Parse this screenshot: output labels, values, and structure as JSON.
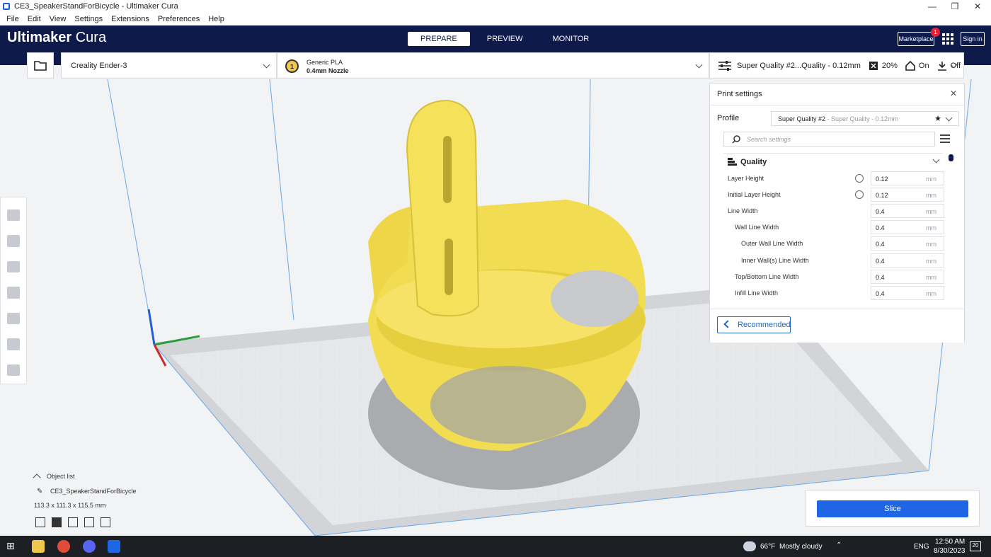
{
  "window": {
    "title": "CE3_SpeakerStandForBicycle - Ultimaker Cura"
  },
  "menu": [
    "File",
    "Edit",
    "View",
    "Settings",
    "Extensions",
    "Preferences",
    "Help"
  ],
  "header": {
    "brand_bold": "Ultimaker",
    "brand_light": " Cura",
    "tabs": [
      {
        "label": "PREPARE"
      },
      {
        "label": "PREVIEW"
      },
      {
        "label": "MONITOR"
      }
    ],
    "marketplace_label": "Marketplace",
    "marketplace_badge": "1",
    "signin_label": "Sign in"
  },
  "toolbar": {
    "printer": "Creality Ender-3",
    "extruder_number": "1",
    "material": "Generic PLA",
    "nozzle": "0.4mm Nozzle",
    "print_profile": "Super Quality #2...Quality - 0.12mm",
    "infill": "20%",
    "support": "On",
    "adhesion": "Off"
  },
  "print_settings": {
    "title": "Print settings",
    "close": "✕",
    "profile_label": "Profile",
    "profile_value": "Super Quality #2",
    "profile_sub": " - Super Quality - 0.12mm",
    "search_placeholder": "Search settings",
    "section": "Quality",
    "settings": [
      {
        "label": "Layer Height",
        "value": "0.12",
        "unit": "mm"
      },
      {
        "label": "Initial Layer Height",
        "value": "0.12",
        "unit": "mm"
      },
      {
        "label": "Line Width",
        "value": "0.4",
        "unit": "mm"
      },
      {
        "label": "Wall Line Width",
        "value": "0.4",
        "unit": "mm"
      },
      {
        "label": "Outer Wall Line Width",
        "value": "0.4",
        "unit": "mm"
      },
      {
        "label": "Inner Wall(s) Line Width",
        "value": "0.4",
        "unit": "mm"
      },
      {
        "label": "Top/Bottom Line Width",
        "value": "0.4",
        "unit": "mm"
      },
      {
        "label": "Infill Line Width",
        "value": "0.4",
        "unit": "mm"
      }
    ],
    "recommended_label": "Recommended"
  },
  "slice": {
    "label": "Slice"
  },
  "object_list": {
    "title": "Object list",
    "object_name": "CE3_SpeakerStandForBicycle",
    "dimensions": "113.3 x 111.3 x 115.5 mm"
  },
  "taskbar": {
    "weather_temp": "66°F",
    "weather_desc": "Mostly cloudy",
    "language": "ENG",
    "time": "12:50 AM",
    "date": "8/30/2023",
    "notification_count": "20"
  },
  "colors": {
    "header_bg": "#0d1a4a",
    "accent": "#1f66e5",
    "model": "#f5e15a",
    "badge": "#e2223a"
  }
}
